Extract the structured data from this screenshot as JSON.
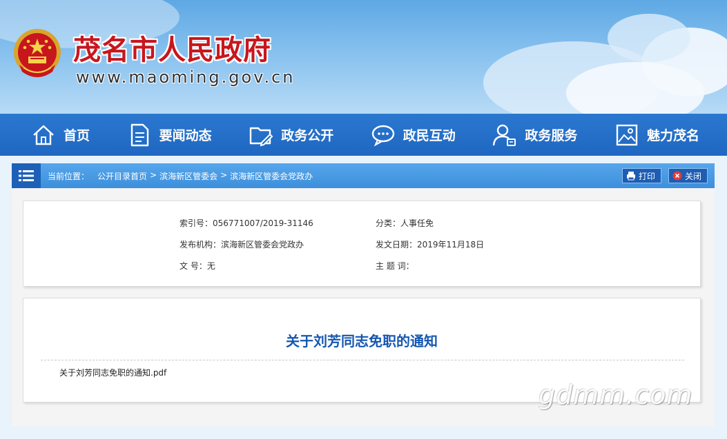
{
  "header": {
    "title": "茂名市人民政府",
    "url": "www.maoming.gov.cn"
  },
  "nav": {
    "items": [
      {
        "label": "首页",
        "icon": "home-icon"
      },
      {
        "label": "要闻动态",
        "icon": "news-icon"
      },
      {
        "label": "政务公开",
        "icon": "folder-edit-icon"
      },
      {
        "label": "政民互动",
        "icon": "chat-icon"
      },
      {
        "label": "政务服务",
        "icon": "user-service-icon"
      },
      {
        "label": "魅力茂名",
        "icon": "picture-icon"
      }
    ]
  },
  "breadcrumb": {
    "label": "当前位置：",
    "path": [
      "公开目录首页",
      "滨海新区管委会",
      "滨海新区管委会党政办"
    ],
    "separator": ">",
    "print_label": "打印",
    "close_label": "关闭"
  },
  "meta": {
    "index_label": "索引号：",
    "index_value": "056771007/2019-31146",
    "category_label": "分类：",
    "category_value": "人事任免",
    "publisher_label": "发布机构：",
    "publisher_value": "滨海新区管委会党政办",
    "date_label": "发文日期：",
    "date_value": "2019年11月18日",
    "docno_label": "文 号：",
    "docno_value": "无",
    "keywords_label": "主 题 词：",
    "keywords_value": ""
  },
  "document": {
    "title": "关于刘芳同志免职的通知",
    "attachment": "关于刘芳同志免职的通知.pdf"
  },
  "watermark": "gdmm.com",
  "colors": {
    "brand_red": "#c8161d",
    "nav_blue": "#2270c6",
    "title_blue": "#1557b0"
  }
}
